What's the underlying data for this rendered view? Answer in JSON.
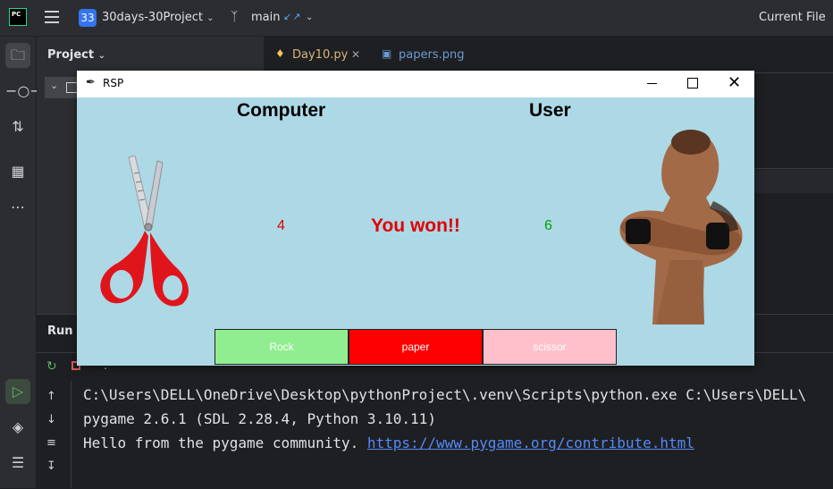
{
  "ide": {
    "logo": "PC",
    "project_badge": "33",
    "project_name": "30days-30Project",
    "branch": "main",
    "current_file": "Current File",
    "panel_title": "Project",
    "tabs": [
      {
        "label": "Day10.py",
        "icon": "python-file-icon",
        "active": true
      },
      {
        "label": "papers.png",
        "icon": "image-file-icon",
        "active": false
      }
    ],
    "run_title": "Run",
    "run_toolbar_extra": ":",
    "console": [
      "C:\\Users\\DELL\\OneDrive\\Desktop\\pythonProject\\.venv\\Scripts\\python.exe C:\\Users\\DELL\\",
      "pygame 2.6.1 (SDL 2.28.4, Python 3.10.11)"
    ],
    "console_hello_prefix": "Hello from the pygame community. ",
    "console_link": "https://www.pygame.org/contribute.html"
  },
  "tk": {
    "title": "RSP",
    "computer_heading": "Computer",
    "user_heading": "User",
    "computer_score": "4",
    "user_score": "6",
    "result": "You won!!",
    "computer_choice_image": "scissors",
    "user_image": "muscular-man-arms-crossed",
    "buttons": {
      "rock": "Rock",
      "paper": "paper",
      "scissor": "scissor"
    },
    "colors": {
      "background": "#add8e6",
      "rock": "#90ee90",
      "paper": "#ff0000",
      "scissor": "#ffc0cb",
      "computer_score": "#e00000",
      "user_score": "#00a000"
    }
  }
}
